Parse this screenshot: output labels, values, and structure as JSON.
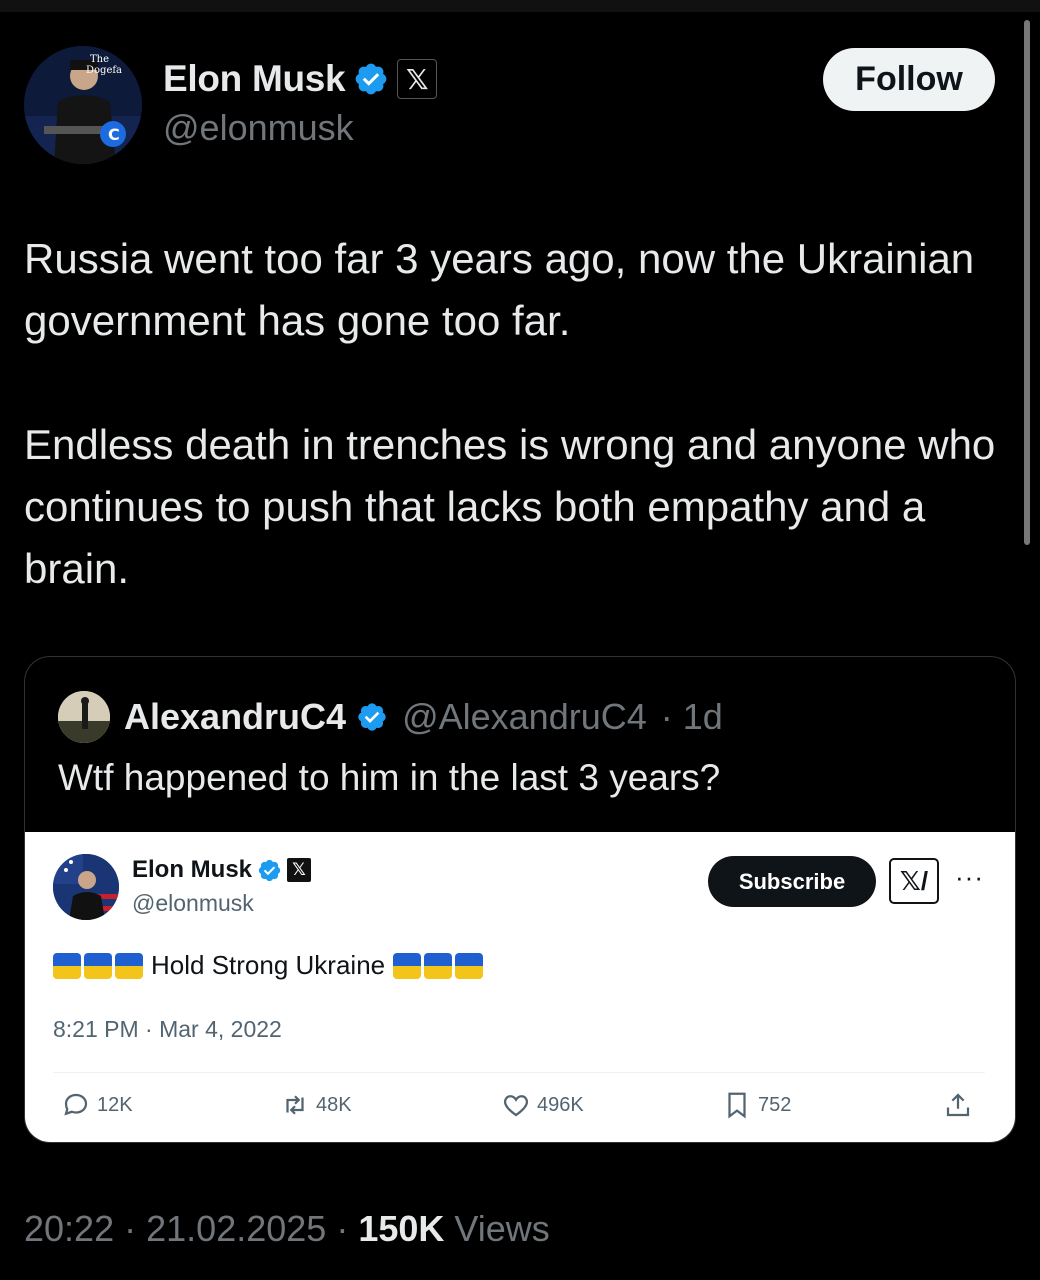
{
  "tweet": {
    "author_name": "Elon Musk",
    "author_handle": "@elonmusk",
    "follow_label": "Follow",
    "paragraph_1": "Russia went too far 3 years ago, now the Ukrainian government has gone too far.",
    "paragraph_2": "Endless death in trenches is wrong and anyone who continues to push that lacks both empathy and a brain.",
    "time": "20:22",
    "date": "21.02.2025",
    "views_count": "150K",
    "views_label": "Views",
    "separator": "·"
  },
  "quote": {
    "author_name": "AlexandruC4",
    "author_handle": "@AlexandruC4",
    "age": "· 1d",
    "text": "Wtf happened to him in the last 3 years?",
    "screenshot": {
      "author_name": "Elon Musk",
      "author_handle": "@elonmusk",
      "subscribe_label": "Subscribe",
      "grok_label": "𝕏/",
      "more_label": "···",
      "body_text": "Hold Strong Ukraine",
      "flags_before": 3,
      "flags_after": 3,
      "timestamp": "8:21 PM · Mar 4, 2022",
      "replies": "12K",
      "reposts": "48K",
      "likes": "496K",
      "bookmarks": "752"
    }
  },
  "colors": {
    "background": "#000000",
    "verified_blue": "#1d9bf0",
    "muted_text": "#71767b",
    "ukraine_blue": "#1f5fd0",
    "ukraine_yellow": "#f3c51a"
  }
}
